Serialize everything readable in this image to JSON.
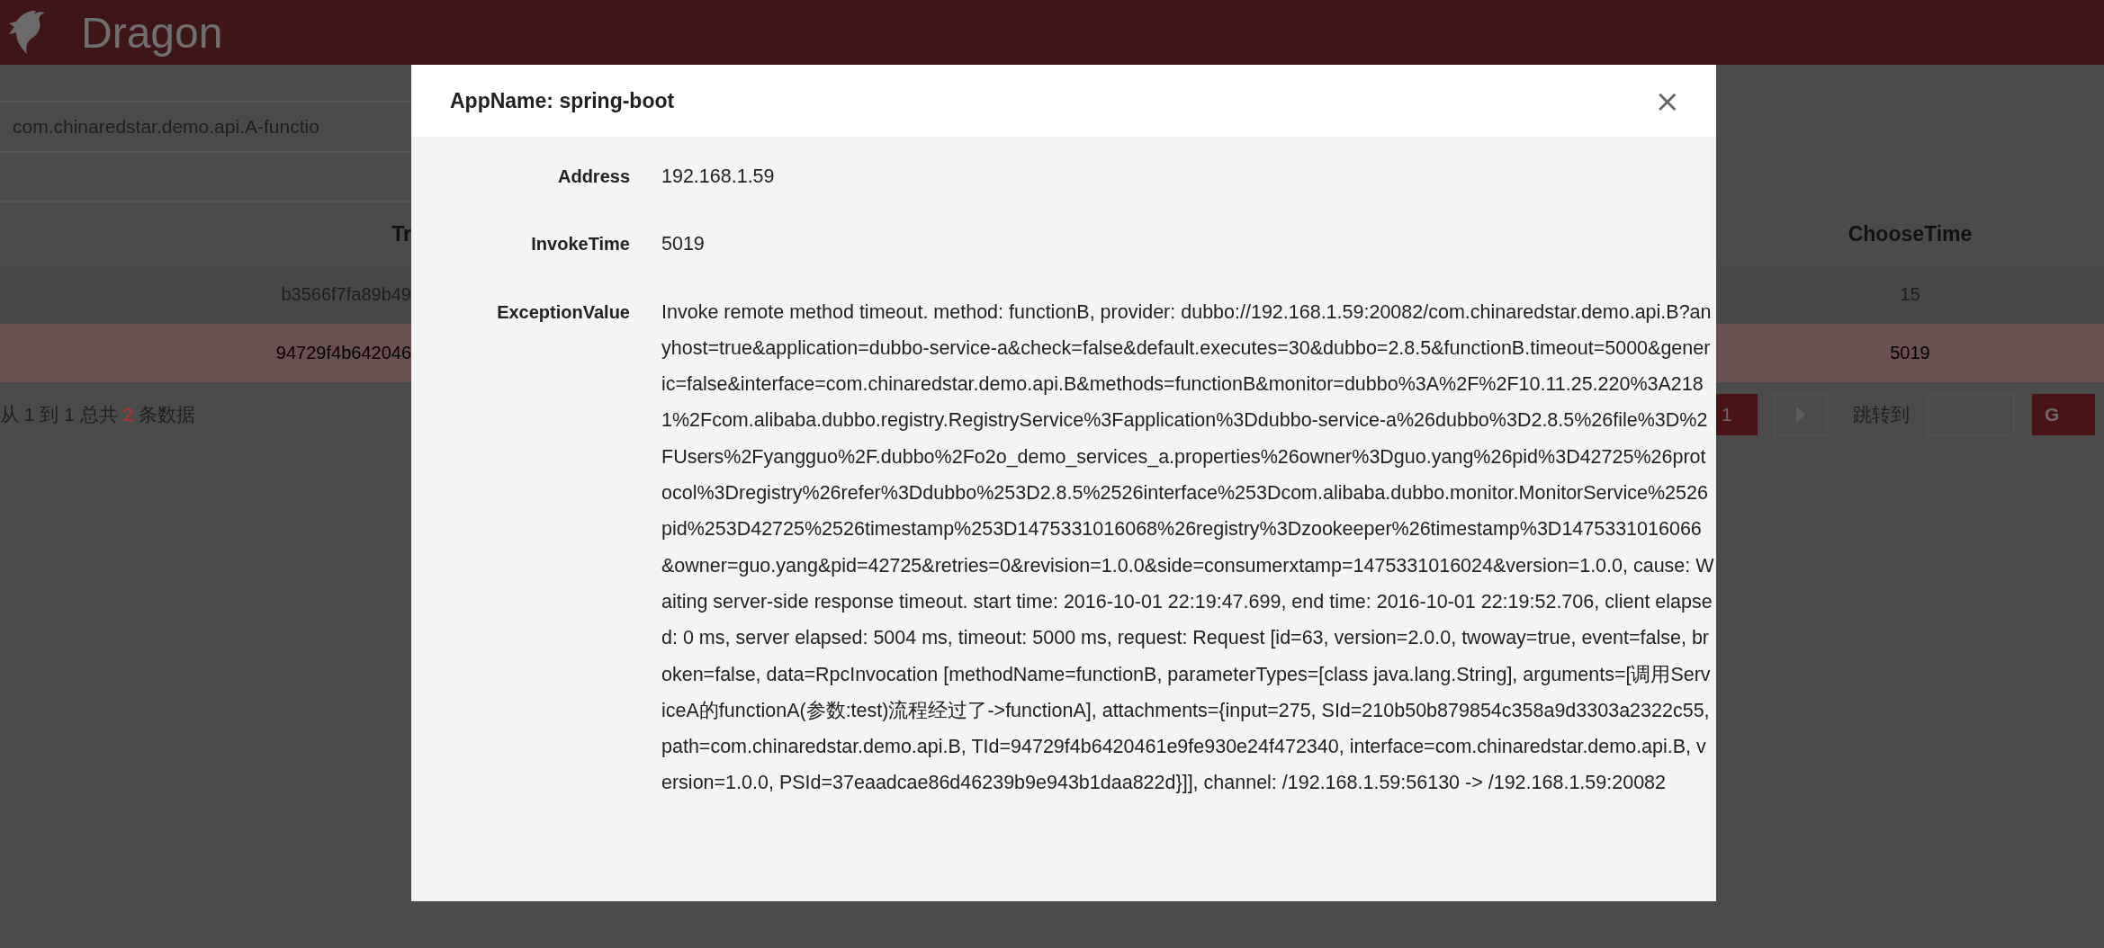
{
  "header": {
    "title": "Dragon"
  },
  "search": {
    "value": "com.chinaredstar.demo.api.A-functio"
  },
  "table": {
    "columns": [
      "Tr",
      "ChooseTime"
    ],
    "rows": [
      {
        "selected": false,
        "cells": [
          "b3566f7fa89b49",
          "15"
        ]
      },
      {
        "selected": true,
        "cells": [
          "94729f4b642046",
          "5019"
        ]
      }
    ]
  },
  "pager": {
    "info_prefix": "从 1 到 1 总共",
    "info_count": "2",
    "info_suffix": "条数据",
    "pages": [
      {
        "label": "1",
        "selected": true
      }
    ],
    "jump_label": "跳转到",
    "go_button": "G"
  },
  "dialog": {
    "title": "AppName: spring-boot",
    "close": "×",
    "fields": [
      {
        "label": "Address",
        "value": "192.168.1.59"
      },
      {
        "label": "InvokeTime",
        "value": "5019"
      },
      {
        "label": "ExceptionValue",
        "value": "Invoke remote method timeout. method: functionB, provider: dubbo://192.168.1.59:20082/com.chinaredstar.demo.api.B?anyhost=true&application=dubbo-service-a&check=false&default.executes=30&dubbo=2.8.5&functionB.timeout=5000&generic=false&interface=com.chinaredstar.demo.api.B&methods=functionB&monitor=dubbo%3A%2F%2F10.11.25.220%3A2181%2Fcom.alibaba.dubbo.registry.RegistryService%3Fapplication%3Ddubbo-service-a%26dubbo%3D2.8.5%26file%3D%2FUsers%2Fyangguo%2F.dubbo%2Fo2o_demo_services_a.properties%26owner%3Dguo.yang%26pid%3D42725%26protocol%3Dregistry%26refer%3Ddubbo%253D2.8.5%2526interface%253Dcom.alibaba.dubbo.monitor.MonitorService%2526pid%253D42725%2526timestamp%253D1475331016068%26registry%3Dzookeeper%26timestamp%3D1475331016066&owner=guo.yang&pid=42725&retries=0&revision=1.0.0&side=consumerxtamp=1475331016024&version=1.0.0, cause: Waiting server-side response timeout. start time: 2016-10-01 22:19:47.699, end time: 2016-10-01 22:19:52.706, client elapsed: 0 ms, server elapsed: 5004 ms, timeout: 5000 ms, request: Request [id=63, version=2.0.0, twoway=true, event=false, broken=false, data=RpcInvocation [methodName=functionB, parameterTypes=[class java.lang.String], arguments=[调用ServiceA的functionA(参数:test)流程经过了->functionA], attachments={input=275, SId=210b50b879854c358a9d3303a2322c55, path=com.chinaredstar.demo.api.B, TId=94729f4b6420461e9fe930e24f472340, interface=com.chinaredstar.demo.api.B, version=1.0.0, PSId=37eaadcae86d46239b9e943b1daa822d}]], channel: /192.168.1.59:56130 -> /192.168.1.59:20082"
      }
    ]
  }
}
